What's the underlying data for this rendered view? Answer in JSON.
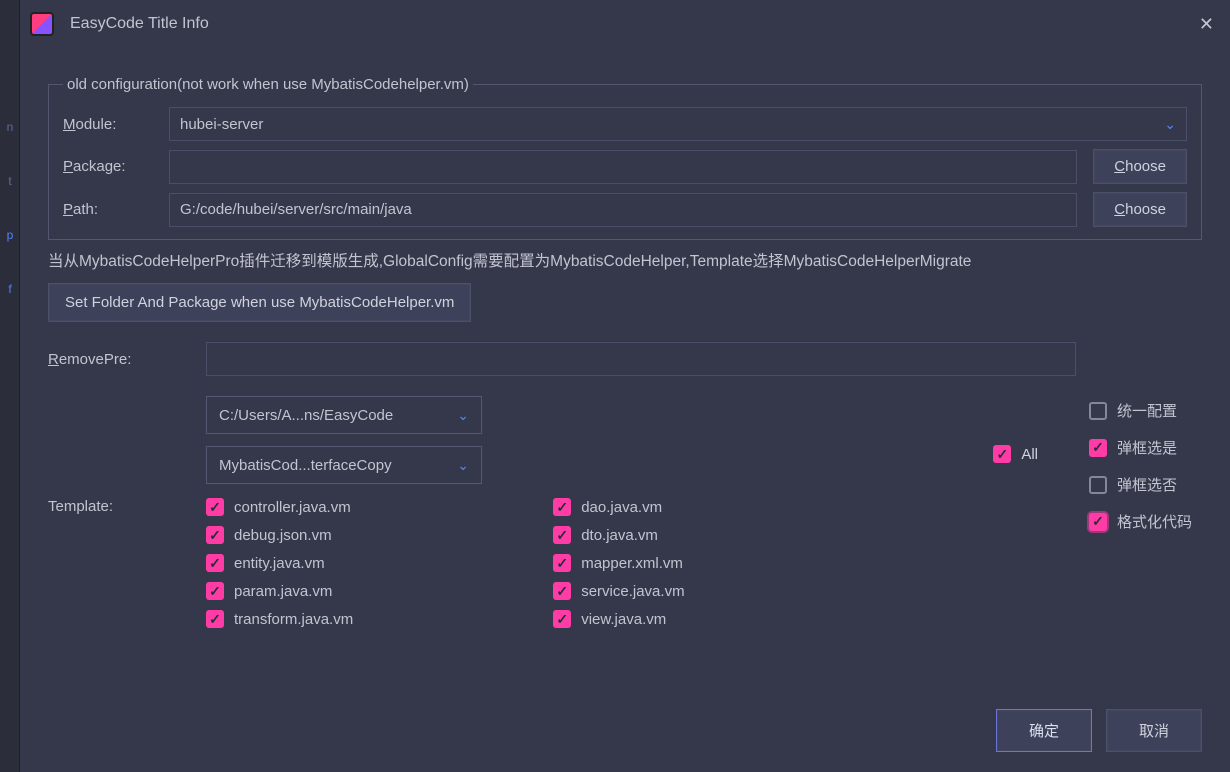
{
  "window": {
    "title": "EasyCode Title Info"
  },
  "fieldset": {
    "legend": "old configuration(not work when use MybatisCodehelper.vm)",
    "module_label": "Module:",
    "module_value": "hubei-server",
    "package_label": "Package:",
    "package_value": "",
    "package_choose": "Choose",
    "path_label": "Path:",
    "path_value": "G:/code/hubei/server/src/main/java",
    "path_choose": "Choose"
  },
  "info_line": "当从MybatisCodeHelperPro插件迁移到模版生成,GlobalConfig需要配置为MybatisCodeHelper,Template选择MybatisCodeHelperMigrate",
  "set_folder_btn": "Set Folder And Package  when use MybatisCodeHelper.vm",
  "remove_pre": {
    "label": "RemovePre:",
    "value": ""
  },
  "dropdowns": {
    "path": "C:/Users/A...ns/EasyCode",
    "template_group": "MybatisCod...terfaceCopy"
  },
  "all_label": "All",
  "template_label": "Template:",
  "templates_col1": [
    {
      "checked": true,
      "label": "controller.java.vm"
    },
    {
      "checked": true,
      "label": "debug.json.vm"
    },
    {
      "checked": true,
      "label": "entity.java.vm"
    },
    {
      "checked": true,
      "label": "param.java.vm"
    },
    {
      "checked": true,
      "label": "transform.java.vm"
    }
  ],
  "templates_col2": [
    {
      "checked": true,
      "label": "dao.java.vm"
    },
    {
      "checked": true,
      "label": "dto.java.vm"
    },
    {
      "checked": true,
      "label": "mapper.xml.vm"
    },
    {
      "checked": true,
      "label": "service.java.vm"
    },
    {
      "checked": true,
      "label": "view.java.vm"
    }
  ],
  "right_options": [
    {
      "checked": false,
      "label": "统一配置"
    },
    {
      "checked": true,
      "label": "弹框选是"
    },
    {
      "checked": false,
      "label": "弹框选否"
    },
    {
      "checked": true,
      "label": "格式化代码",
      "ring": true
    }
  ],
  "footer": {
    "ok": "确定",
    "cancel": "取消"
  }
}
